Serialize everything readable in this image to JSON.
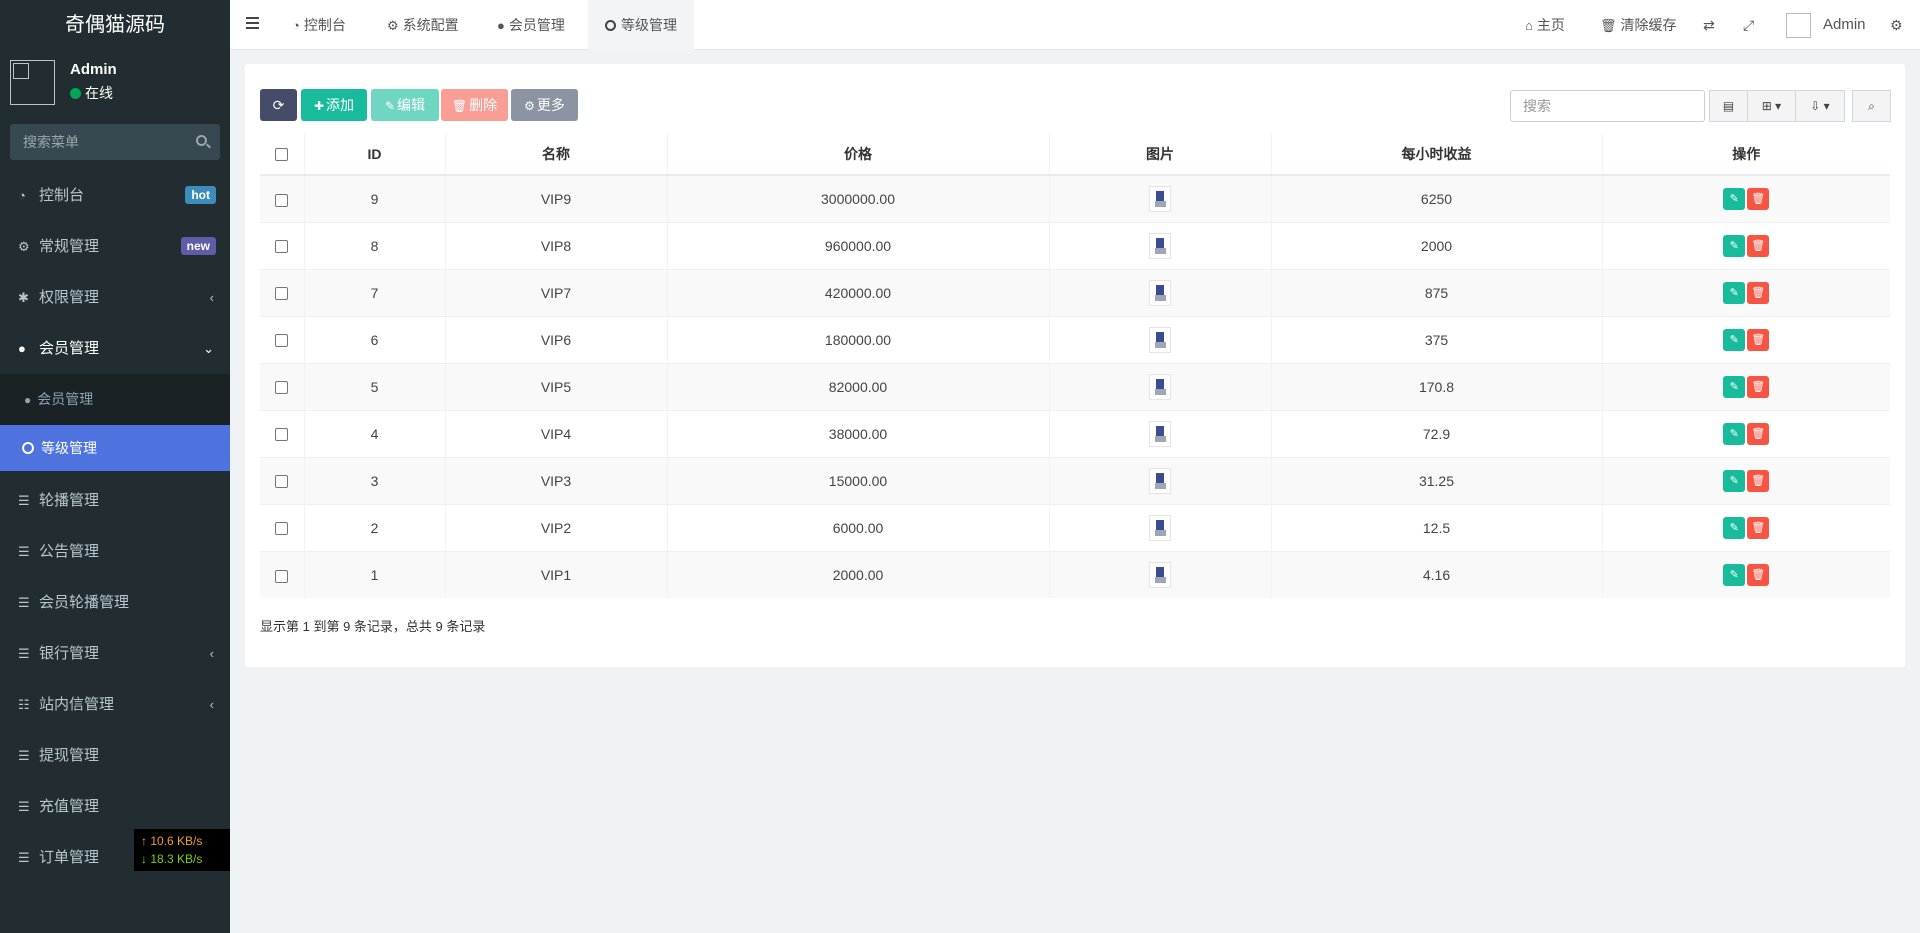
{
  "sidebar": {
    "logo": "奇偶猫源码",
    "user": {
      "name": "Admin",
      "status": "在线"
    },
    "search_placeholder": "搜索菜单",
    "items": [
      {
        "label": "控制台",
        "icon": "dashboard-icon",
        "glyph": "◔",
        "badge": "hot",
        "badge_color": "#3c8dbc"
      },
      {
        "label": "常规管理",
        "icon": "cogs-icon",
        "glyph": "⚙",
        "badge": "new",
        "badge_color": "#605ca8"
      },
      {
        "label": "权限管理",
        "icon": "users-icon",
        "glyph": "👥",
        "chevron": "‹"
      },
      {
        "label": "会员管理",
        "icon": "user-circle-icon",
        "glyph": "●",
        "chevron": "⌄"
      },
      {
        "label": "轮播管理",
        "icon": "list-icon",
        "glyph": "☰"
      },
      {
        "label": "公告管理",
        "icon": "list-icon",
        "glyph": "☰"
      },
      {
        "label": "会员轮播管理",
        "icon": "list-icon",
        "glyph": "☰"
      },
      {
        "label": "银行管理",
        "icon": "list-icon",
        "glyph": "☰",
        "chevron": "‹"
      },
      {
        "label": "站内信管理",
        "icon": "list-ul-icon",
        "glyph": "☷",
        "chevron": "‹"
      },
      {
        "label": "提现管理",
        "icon": "list-icon",
        "glyph": "☰"
      },
      {
        "label": "充值管理",
        "icon": "list-icon",
        "glyph": "☰"
      },
      {
        "label": "订单管理",
        "icon": "list-icon",
        "glyph": "☰"
      }
    ],
    "sub_item": "会员管理",
    "active_item": "等级管理",
    "net": {
      "up": "↑ 10.6 KB/s",
      "down": "↓ 18.3 KB/s"
    }
  },
  "topbar": {
    "tabs": [
      {
        "label": "控制台",
        "icon": "dashboard-icon"
      },
      {
        "label": "系统配置",
        "icon": "gear-icon"
      },
      {
        "label": "会员管理",
        "icon": "user-icon"
      },
      {
        "label": "等级管理",
        "icon": "circle-icon"
      }
    ],
    "right": {
      "home": "主页",
      "clear_cache": "清除缓存",
      "user": "Admin"
    }
  },
  "toolbar": {
    "add": "添加",
    "edit": "编辑",
    "delete": "删除",
    "more": "更多",
    "search_placeholder": "搜索"
  },
  "table": {
    "headers": [
      "ID",
      "名称",
      "价格",
      "图片",
      "每小时收益",
      "操作"
    ],
    "rows": [
      {
        "id": "9",
        "name": "VIP9",
        "price": "3000000.00",
        "income": "6250"
      },
      {
        "id": "8",
        "name": "VIP8",
        "price": "960000.00",
        "income": "2000"
      },
      {
        "id": "7",
        "name": "VIP7",
        "price": "420000.00",
        "income": "875"
      },
      {
        "id": "6",
        "name": "VIP6",
        "price": "180000.00",
        "income": "375"
      },
      {
        "id": "5",
        "name": "VIP5",
        "price": "82000.00",
        "income": "170.8"
      },
      {
        "id": "4",
        "name": "VIP4",
        "price": "38000.00",
        "income": "72.9"
      },
      {
        "id": "3",
        "name": "VIP3",
        "price": "15000.00",
        "income": "31.25"
      },
      {
        "id": "2",
        "name": "VIP2",
        "price": "6000.00",
        "income": "12.5"
      },
      {
        "id": "1",
        "name": "VIP1",
        "price": "2000.00",
        "income": "4.16"
      }
    ]
  },
  "pagination_info": "显示第 1 到第 9 条记录，总共 9 条记录",
  "colors": {
    "sidebar": "#222d32",
    "active": "#4e73df",
    "add": "#18bc9c",
    "delete": "#f75444",
    "dark_btn": "#444c69"
  }
}
